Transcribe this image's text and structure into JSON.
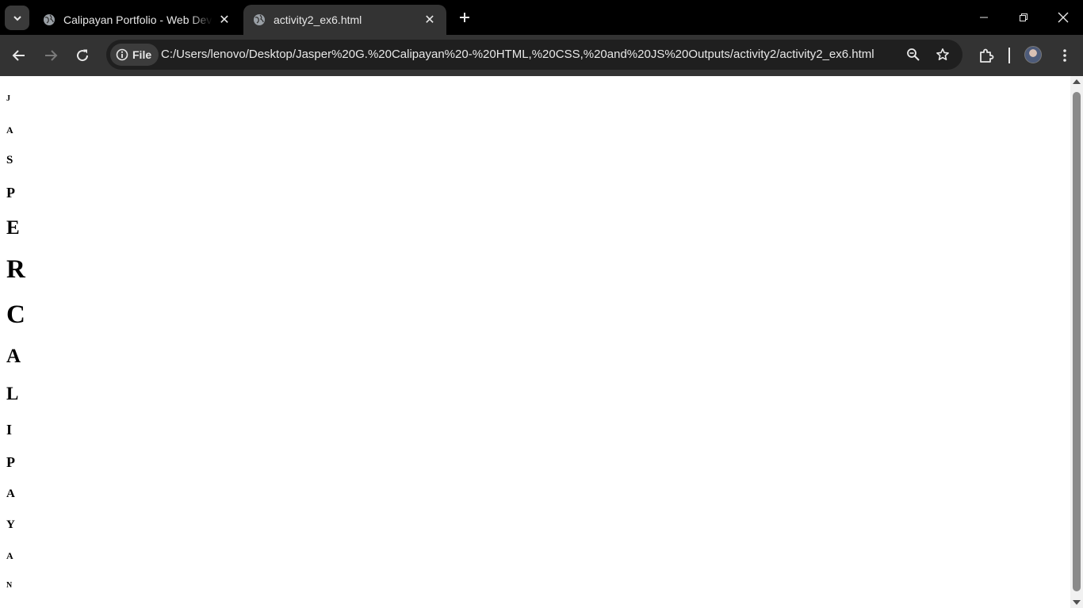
{
  "tabs": [
    {
      "title": "Calipayan Portfolio - Web Developer",
      "icon": "globe-icon",
      "active": false
    },
    {
      "title": "activity2_ex6.html",
      "icon": "globe-icon",
      "active": true
    }
  ],
  "toolbar": {
    "chip_label": "File",
    "url": "C:/Users/lenovo/Desktop/Jasper%20G.%20Calipayan%20-%20HTML,%20CSS,%20and%20JS%20Outputs/activity2/activity2_ex6.html"
  },
  "page": {
    "letters": [
      "J",
      "A",
      "S",
      "P",
      "E",
      "R",
      "C",
      "A",
      "L",
      "I",
      "P",
      "A",
      "Y",
      "A",
      "N"
    ]
  },
  "colors": {
    "tab_strip": "#000000",
    "toolbar": "#333333",
    "omnibox": "#1f1f1f",
    "page_background": "#ffffff",
    "text": "#e8e8e8"
  }
}
